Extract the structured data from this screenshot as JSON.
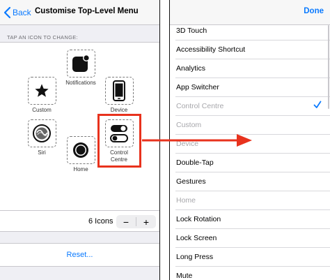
{
  "left": {
    "nav": {
      "back_label": "Back",
      "title": "Customise Top-Level Menu"
    },
    "section_label": "TAP AN ICON TO CHANGE:",
    "slots": {
      "notifications": "Notifications",
      "custom": "Custom",
      "device": "Device",
      "siri": "Siri",
      "home": "Home",
      "control_centre_line1": "Control",
      "control_centre_line2": "Centre"
    },
    "icons_count": "6 Icons",
    "stepper": {
      "minus": "−",
      "plus": "+"
    },
    "reset_label": "Reset..."
  },
  "right": {
    "done_label": "Done",
    "items": [
      {
        "label": "3D Touch"
      },
      {
        "label": "Accessibility Shortcut"
      },
      {
        "label": "Analytics"
      },
      {
        "label": "App Switcher"
      },
      {
        "label": "Control Centre"
      },
      {
        "label": "Custom"
      },
      {
        "label": "Device"
      },
      {
        "label": "Double-Tap"
      },
      {
        "label": "Gestures"
      },
      {
        "label": "Home"
      },
      {
        "label": "Lock Rotation"
      },
      {
        "label": "Lock Screen"
      },
      {
        "label": "Long Press"
      },
      {
        "label": "Mute"
      }
    ]
  },
  "colors": {
    "ios_blue": "#0a7aff",
    "highlight_red": "#e8321d",
    "grouped_bg": "#efeff4",
    "dim_text": "#a7a7ab"
  },
  "icons": [
    "chevron-left-icon",
    "notifications-icon",
    "star-icon",
    "iphone-icon",
    "siri-icon",
    "home-button-icon",
    "toggle-switches-icon",
    "checkmark-icon",
    "red-arrow-icon"
  ]
}
